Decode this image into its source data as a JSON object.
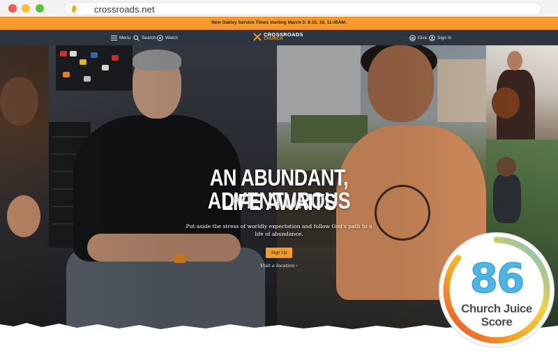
{
  "browser": {
    "url": "crossroads.net"
  },
  "announcement": {
    "text": "New Oakley Service Times starting March 5: 8:15, 10, 11:45AM."
  },
  "nav": {
    "menu_label": "Menu",
    "search_label": "Search",
    "watch_label": "Watch",
    "logo_line1": "CROSSROADS",
    "logo_line2": "CHURCH",
    "give_label": "Give",
    "signin_label": "Sign In"
  },
  "hero": {
    "headline_line1": "AN ABUNDANT, ADVENTUROUS",
    "headline_line2": "LIFE AWAITS",
    "subtext": "Put aside the stress of worldly expectation and follow God's path to a life of abundance.",
    "cta_label": "Sign Up",
    "link_label": "Visit a location ›"
  },
  "score_badge": {
    "score": "86",
    "score_value": 86,
    "line1": "Church Juice",
    "line2": "Score"
  },
  "colors": {
    "accent_orange": "#f79a2e",
    "nav_bg": "#2c3540",
    "score_blue": "#4bb5e6"
  }
}
